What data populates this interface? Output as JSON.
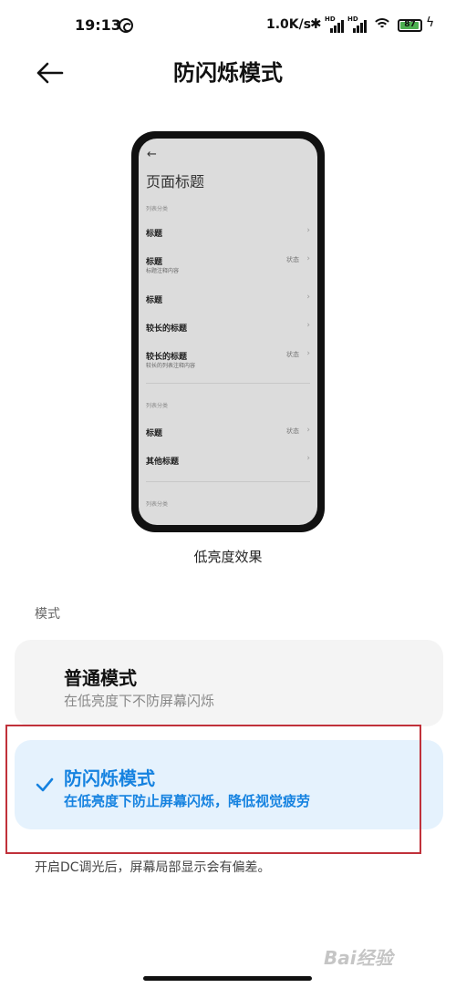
{
  "status_bar": {
    "time": "19:13",
    "network_speed": "1.0K/s",
    "battery_level": "87",
    "signal_label": "HD",
    "icons": [
      "app-notification-icon",
      "bluetooth-icon",
      "signal-icon",
      "wifi-icon",
      "battery-icon",
      "charging-icon"
    ]
  },
  "header": {
    "title": "防闪烁模式",
    "back_icon": "back-arrow-icon"
  },
  "preview": {
    "back_glyph": "←",
    "page_title": "页面标题",
    "sections": [
      {
        "label": "列表分类",
        "rows": [
          {
            "title": "标题",
            "subtitle": "",
            "status": ""
          },
          {
            "title": "标题",
            "subtitle": "标题注释内容",
            "status": "状态"
          },
          {
            "title": "标题",
            "subtitle": "",
            "status": ""
          },
          {
            "title": "较长的标题",
            "subtitle": "",
            "status": ""
          },
          {
            "title": "较长的标题",
            "subtitle": "较长的列表注释内容",
            "status": "状态"
          }
        ]
      },
      {
        "label": "列表分类",
        "rows": [
          {
            "title": "标题",
            "subtitle": "",
            "status": "状态"
          },
          {
            "title": "其他标题",
            "subtitle": "",
            "status": ""
          }
        ]
      },
      {
        "label": "列表分类",
        "rows": []
      }
    ],
    "chevron": "›",
    "caption": "低亮度效果"
  },
  "mode_section": {
    "label": "模式",
    "options": [
      {
        "title": "普通模式",
        "description": "在低亮度下不防屏幕闪烁",
        "selected": false
      },
      {
        "title": "防闪烁模式",
        "description": "在低亮度下防止屏幕闪烁，降低视觉疲劳",
        "selected": true
      }
    ]
  },
  "footnote": "开启DC调光后，屏幕局部显示会有偏差。",
  "watermark": "Baidu 经验",
  "colors": {
    "accent": "#1582e0",
    "selected_card_bg": "#e5f2fd",
    "card_bg": "#f4f4f4",
    "annotation_box": "#c0313a",
    "battery_fill": "#4caf50"
  }
}
